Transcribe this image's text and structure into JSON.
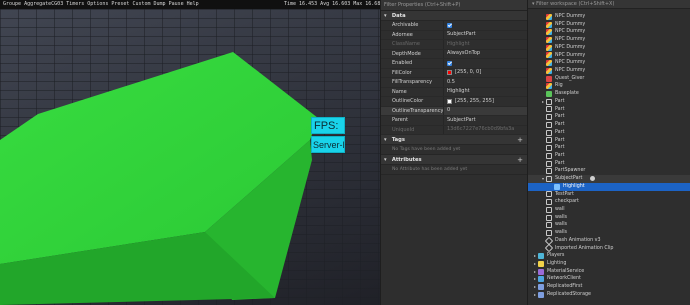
{
  "viewport": {
    "topbar_text": "Groupe AggregateCG03 Timers Options Preset Custom Dump Pause Help",
    "topbar_stats": "Time 16.453 Avg 16.603 Max 16.683",
    "gui": {
      "fps_label": "FPS:",
      "server_fps_label": "Server-FPS:"
    },
    "colors": {
      "block": "#2fd43a",
      "gui": "#19d3ea",
      "ground": "#3b3f47"
    }
  },
  "properties": {
    "filter_placeholder": "Filter Properties (Ctrl+Shift+P)",
    "sections": {
      "data": "Data",
      "tags": "Tags",
      "tags_empty": "No Tags have been added yet",
      "attributes": "Attributes",
      "attributes_empty": "No Attribute has been added yet"
    },
    "rows": [
      {
        "name": "Archivable",
        "value": "",
        "kind": "check"
      },
      {
        "name": "Adornee",
        "value": "SubjectPart",
        "kind": "text"
      },
      {
        "name": "ClassName",
        "value": "Highlight",
        "kind": "dim"
      },
      {
        "name": "DepthMode",
        "value": "AlwaysOnTop",
        "kind": "text"
      },
      {
        "name": "Enabled",
        "value": "",
        "kind": "check"
      },
      {
        "name": "FillColor",
        "value": "[255, 0, 0]",
        "kind": "color",
        "color": "#ff0000"
      },
      {
        "name": "FillTransparency",
        "value": "0.5",
        "kind": "text"
      },
      {
        "name": "Name",
        "value": "Highlight",
        "kind": "text"
      },
      {
        "name": "OutlineColor",
        "value": "[255, 255, 255]",
        "kind": "color",
        "color": "#ffffff"
      },
      {
        "name": "OutlineTransparency",
        "value": "0",
        "kind": "text",
        "highlight": true
      },
      {
        "name": "Parent",
        "value": "SubjectPart",
        "kind": "text"
      },
      {
        "name": "UniqueId",
        "value": "13d6c7227e76cb0d9bfa3a",
        "kind": "dim"
      }
    ]
  },
  "explorer": {
    "filter_placeholder": "Filter workspace (Ctrl+Shift+X)",
    "items": [
      {
        "label": "NPC Dummy",
        "icon": "npc",
        "indent": 1
      },
      {
        "label": "NPC Dummy",
        "icon": "npc",
        "indent": 1
      },
      {
        "label": "NPC Dummy",
        "icon": "npc",
        "indent": 1
      },
      {
        "label": "NPC Dummy",
        "icon": "npc",
        "indent": 1
      },
      {
        "label": "NPC Dummy",
        "icon": "npc",
        "indent": 1
      },
      {
        "label": "NPC Dummy",
        "icon": "npc",
        "indent": 1
      },
      {
        "label": "NPC Dummy",
        "icon": "npc",
        "indent": 1
      },
      {
        "label": "NPC Dummy",
        "icon": "npc",
        "indent": 1
      },
      {
        "label": "Quest_Giver",
        "icon": "quest",
        "indent": 1
      },
      {
        "label": "Rig",
        "icon": "npc",
        "indent": 1
      },
      {
        "label": "Baseplate",
        "icon": "base",
        "indent": 1
      },
      {
        "label": "Part",
        "icon": "part",
        "indent": 1,
        "arrow": "▸"
      },
      {
        "label": "Part",
        "icon": "part",
        "indent": 1
      },
      {
        "label": "Part",
        "icon": "part",
        "indent": 1
      },
      {
        "label": "Part",
        "icon": "part",
        "indent": 1
      },
      {
        "label": "Part",
        "icon": "part",
        "indent": 1
      },
      {
        "label": "Part",
        "icon": "part",
        "indent": 1
      },
      {
        "label": "Part",
        "icon": "part",
        "indent": 1
      },
      {
        "label": "Part",
        "icon": "part",
        "indent": 1
      },
      {
        "label": "Part",
        "icon": "part",
        "indent": 1
      },
      {
        "label": "PartSpawner",
        "icon": "part",
        "indent": 1
      },
      {
        "label": "SubjectPart",
        "icon": "part",
        "indent": 1,
        "arrow": "▾",
        "state": "parent-sel",
        "eye": true
      },
      {
        "label": "Highlight",
        "icon": "hl",
        "indent": 2,
        "state": "selected"
      },
      {
        "label": "TestPart",
        "icon": "part",
        "indent": 1
      },
      {
        "label": "checkpart",
        "icon": "part",
        "indent": 1
      },
      {
        "label": "wall",
        "icon": "part",
        "indent": 1
      },
      {
        "label": "walls",
        "icon": "part",
        "indent": 1
      },
      {
        "label": "walls",
        "icon": "part",
        "indent": 1
      },
      {
        "label": "walls",
        "icon": "part",
        "indent": 1
      },
      {
        "label": "Dash Animation v3",
        "icon": "anim",
        "indent": 1
      },
      {
        "label": "Imported Animation Clip",
        "icon": "anim",
        "indent": 1
      },
      {
        "label": "Players",
        "icon": "players",
        "indent": 0,
        "arrow": "▸"
      },
      {
        "label": "Lighting",
        "icon": "light",
        "indent": 0,
        "arrow": "▸"
      },
      {
        "label": "MaterialService",
        "icon": "mat",
        "indent": 0,
        "arrow": "▸"
      },
      {
        "label": "NetworkClient",
        "icon": "net",
        "indent": 0,
        "arrow": "▸"
      },
      {
        "label": "ReplicatedFirst",
        "icon": "rep",
        "indent": 0,
        "arrow": "▸"
      },
      {
        "label": "ReplicatedStorage",
        "icon": "rep",
        "indent": 0,
        "arrow": "▸"
      }
    ]
  }
}
